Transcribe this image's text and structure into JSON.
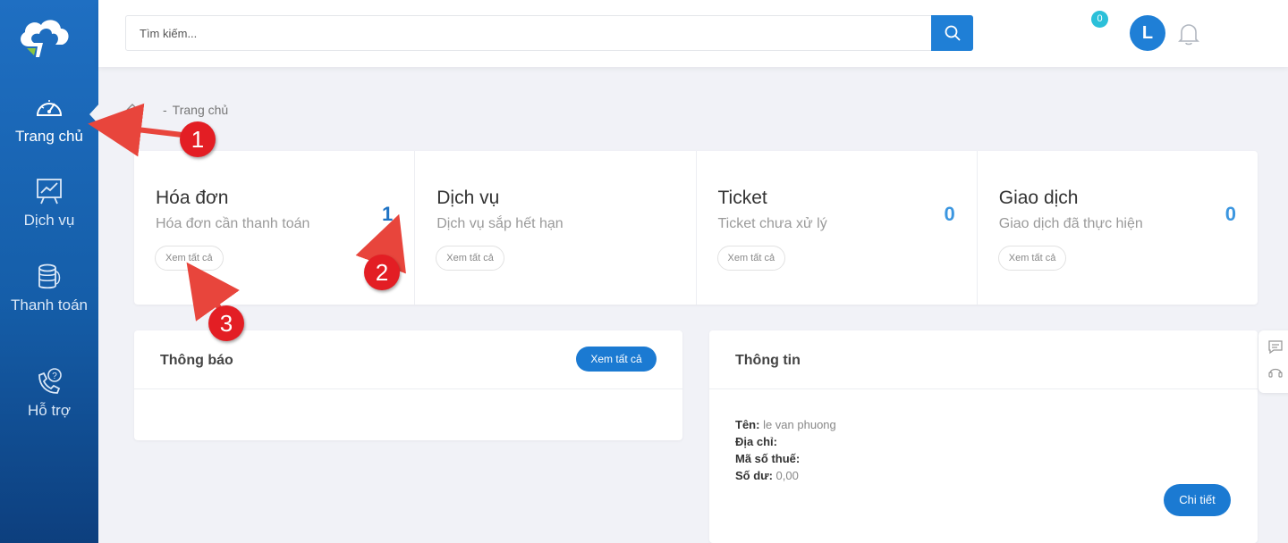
{
  "sidebar": {
    "items": [
      {
        "label": "Trang chủ",
        "icon": "speedometer-icon",
        "active": true
      },
      {
        "label": "Dịch vụ",
        "icon": "chart-board-icon"
      },
      {
        "label": "Thanh toán",
        "icon": "coin-stack-icon"
      },
      {
        "label": "Hỗ trợ",
        "icon": "support-phone-icon"
      }
    ]
  },
  "header": {
    "search_placeholder": "Tìm kiếm...",
    "notification_count": "0",
    "avatar_initial": "L"
  },
  "breadcrumb": {
    "sep": "-",
    "current": "Trang chủ"
  },
  "stats": [
    {
      "title": "Hóa đơn",
      "subtitle": "Hóa đơn cần thanh toán",
      "value": "1",
      "link": "Xem tất cả"
    },
    {
      "title": "Dịch vụ",
      "subtitle": "Dịch vụ sắp hết hạn",
      "value": "",
      "link": "Xem tất cả"
    },
    {
      "title": "Ticket",
      "subtitle": "Ticket chưa xử lý",
      "value": "0",
      "link": "Xem tất cả"
    },
    {
      "title": "Giao dịch",
      "subtitle": "Giao dịch đã thực hiện",
      "value": "0",
      "link": "Xem tất cả"
    }
  ],
  "notice": {
    "title": "Thông báo",
    "view_all": "Xem tất cả"
  },
  "info": {
    "title": "Thông tin",
    "name_label": "Tên:",
    "name_value": "le van phuong",
    "address_label": "Địa chỉ:",
    "address_value": "",
    "tax_label": "Mã số thuế:",
    "tax_value": "",
    "balance_label": "Số dư:",
    "balance_value": "0,00",
    "detail_button": "Chi tiết"
  },
  "annotations": [
    "1",
    "2",
    "3"
  ],
  "colors": {
    "primary": "#1f7fd6",
    "annotation": "#e31e24",
    "badge": "#2bc0d9"
  }
}
